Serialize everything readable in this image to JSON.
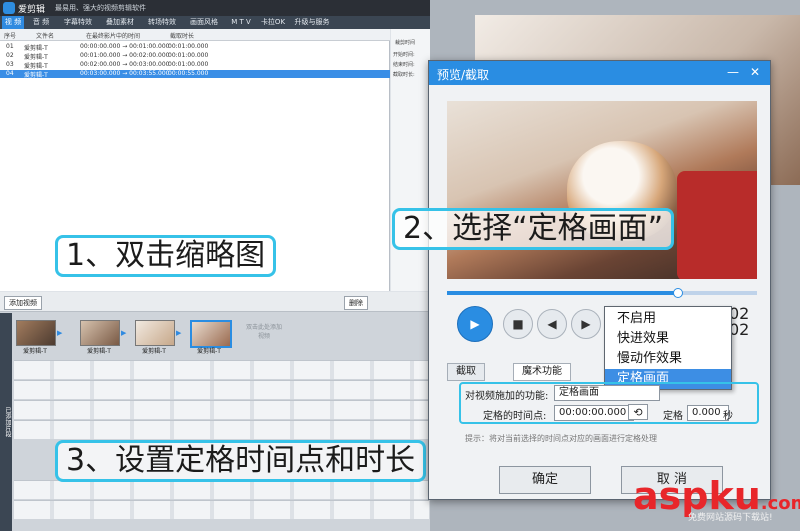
{
  "app": {
    "title": "爱剪辑",
    "slogan": "最易用、强大的视频剪辑软件"
  },
  "tabs": [
    "视 频",
    "音 频",
    "字幕特效",
    "叠加素材",
    "转场特效",
    "画面风格",
    "M T V",
    "卡拉OK",
    "升级与服务"
  ],
  "media": {
    "columns": [
      "序号",
      "文件名",
      "在最终影片中的时间",
      "截取时长"
    ],
    "rows": [
      [
        "01",
        "爱剪辑-T",
        "00:00:00.000 → 00:01:00.000",
        "00:01:00.000"
      ],
      [
        "02",
        "爱剪辑-T",
        "00:01:00.000 → 00:02:00.000",
        "00:01:00.000"
      ],
      [
        "03",
        "爱剪辑-T",
        "00:02:00.000 → 00:03:00.000",
        "00:01:00.000"
      ],
      [
        "04",
        "爱剪辑-T",
        "00:03:00.000 → 00:03:55.000",
        "00:00:55.000"
      ]
    ]
  },
  "right_panel": {
    "title": "裁剪时间",
    "start": "开始时间:",
    "start_val": "00:03:00.950",
    "end": "结束时间:",
    "end_val": "00:03:00.000",
    "dur": "截取时长:"
  },
  "toolbar": {
    "add": "添加视频",
    "delete": "删除"
  },
  "side_label": "已添加片段",
  "thumbs": [
    "爱剪辑-T",
    "爱剪辑-T",
    "爱剪辑-T",
    "爱剪辑-T"
  ],
  "empty_slot": "双击此处添加视频",
  "annotations": {
    "a1": "1、双击缩略图",
    "a2": "2、选择“定格画面”",
    "a3": "3、设置定格时间点和时长"
  },
  "dialog": {
    "title": "预览/截取",
    "min": "—",
    "close": "✕",
    "timecode": "02\n02",
    "menu": [
      "不启用",
      "快进效果",
      "慢动作效果",
      "定格画面"
    ],
    "menu_selected": 3,
    "tab_cut": "截取",
    "tab_magic": "魔术功能",
    "func_label": "对视频施加的功能:",
    "func_value": "定格画面",
    "time_label": "定格的时间点:",
    "time_value": "00:00:00.000",
    "dur_label": "定格",
    "dur_value": "0.000",
    "dur_unit": "秒",
    "hint": "提示：将对当前选择的时间点对应的画面进行定格处理",
    "ok": "确定",
    "cancel": "取 消"
  },
  "watermark": {
    "brand": "aspku",
    "com": ".com",
    "sub": "免费网站源码下载站!"
  },
  "colors": {
    "accent": "#2a8de2",
    "highlight": "#36c2e8",
    "watermark": "#e8262a"
  }
}
